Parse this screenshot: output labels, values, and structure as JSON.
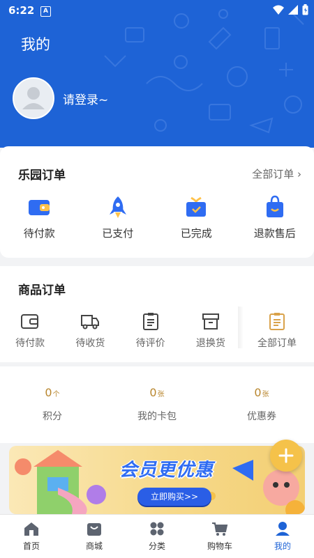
{
  "status_bar": {
    "time": "6:22",
    "badge": "A"
  },
  "header": {
    "title": "我的",
    "login_text": "请登录~"
  },
  "park_orders": {
    "title": "乐园订单",
    "all_link": "全部订单",
    "items": [
      {
        "label": "待付款",
        "icon": "wallet-icon"
      },
      {
        "label": "已支付",
        "icon": "rocket-icon"
      },
      {
        "label": "已完成",
        "icon": "gift-icon"
      },
      {
        "label": "退款售后",
        "icon": "bag-icon"
      }
    ]
  },
  "goods_orders": {
    "title": "商品订单",
    "items": [
      {
        "label": "待付款",
        "icon": "wallet-icon"
      },
      {
        "label": "待收货",
        "icon": "truck-icon"
      },
      {
        "label": "待评价",
        "icon": "clipboard-icon"
      },
      {
        "label": "退换货",
        "icon": "box-icon"
      }
    ],
    "all_label": "全部订单"
  },
  "stats": [
    {
      "value": "0",
      "unit": "个",
      "label": "积分"
    },
    {
      "value": "0",
      "unit": "张",
      "label": "我的卡包"
    },
    {
      "value": "0",
      "unit": "张",
      "label": "优惠券"
    }
  ],
  "banner": {
    "headline": "会员更优惠",
    "button": "立即购买>>"
  },
  "tabbar": [
    {
      "label": "首页",
      "icon": "home-icon",
      "active": false
    },
    {
      "label": "商城",
      "icon": "shop-icon",
      "active": false
    },
    {
      "label": "分类",
      "icon": "category-icon",
      "active": false
    },
    {
      "label": "购物车",
      "icon": "cart-icon",
      "active": false
    },
    {
      "label": "我的",
      "icon": "profile-icon",
      "active": true
    }
  ],
  "colors": {
    "primary": "#1e63d6",
    "gold": "#b8862e",
    "fab": "#f5c24a"
  }
}
